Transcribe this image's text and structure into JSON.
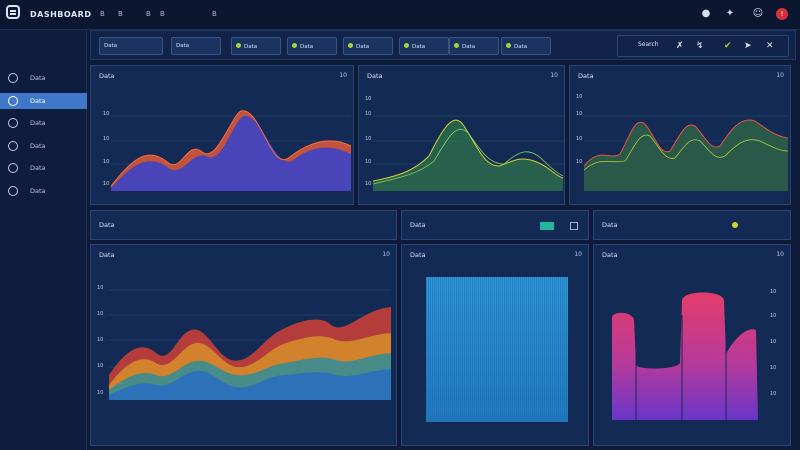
{
  "app": {
    "brand": "DASHBOARD"
  },
  "topmenu": [
    "B",
    "B",
    "B",
    "B",
    "B"
  ],
  "sidebar": {
    "items": [
      {
        "label": "Data",
        "active": false
      },
      {
        "label": "Data",
        "active": true
      },
      {
        "label": "Data",
        "active": false
      },
      {
        "label": "Data",
        "active": false
      },
      {
        "label": "Data",
        "active": false
      },
      {
        "label": "Data",
        "active": false
      }
    ]
  },
  "toolbar": {
    "buttons": [
      "Data",
      "Data",
      "Data",
      "Data",
      "Data",
      "Data",
      "Data",
      "Data"
    ],
    "search_placeholder": "Search"
  },
  "panels": {
    "top1": {
      "title": "Data",
      "corner": "10"
    },
    "top2": {
      "title": "Data",
      "corner": "10"
    },
    "top3": {
      "title": "Data",
      "corner": "10"
    },
    "mid1": {
      "title": "Data",
      "corner": ""
    },
    "mid2": {
      "title": "Data",
      "corner": ""
    },
    "mid3": {
      "title": "Data",
      "corner": ""
    },
    "big1": {
      "title": "Data",
      "corner": "10"
    },
    "big2": {
      "title": "Data",
      "corner": "10"
    },
    "big3": {
      "title": "Data",
      "corner": "10"
    }
  },
  "colors": {
    "accent": "#3f77c9",
    "green": "#a8d23a",
    "red": "#d6303a",
    "panel": "#132a55"
  }
}
